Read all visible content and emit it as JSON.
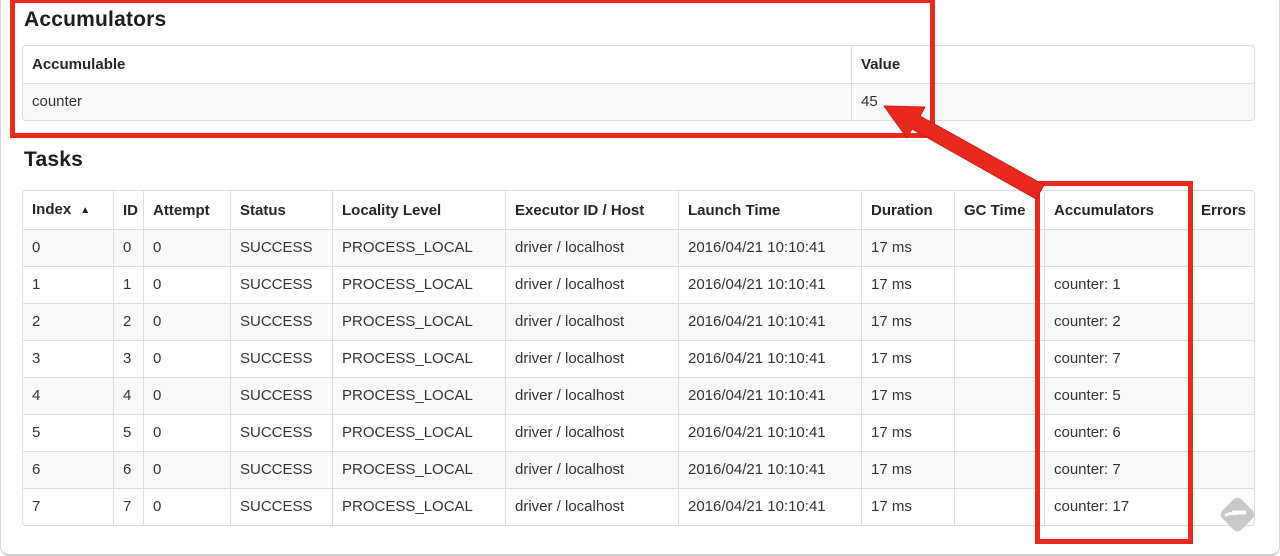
{
  "accumulators_section": {
    "title": "Accumulators",
    "table": {
      "headers": [
        "Accumulable",
        "Value"
      ],
      "rows": [
        {
          "accumulable": "counter",
          "value": "45"
        }
      ]
    }
  },
  "tasks_section": {
    "title": "Tasks",
    "table": {
      "headers": [
        "Index",
        "ID",
        "Attempt",
        "Status",
        "Locality Level",
        "Executor ID / Host",
        "Launch Time",
        "Duration",
        "GC Time",
        "Accumulators",
        "Errors"
      ],
      "sort_column": "Index",
      "sort_direction": "ascending",
      "sort_icon": "▲",
      "rows": [
        {
          "index": "0",
          "id": "0",
          "attempt": "0",
          "status": "SUCCESS",
          "locality_level": "PROCESS_LOCAL",
          "executor_id_host": "driver / localhost",
          "launch_time": "2016/04/21 10:10:41",
          "duration": "17 ms",
          "gc_time": "",
          "accumulators": "",
          "errors": ""
        },
        {
          "index": "1",
          "id": "1",
          "attempt": "0",
          "status": "SUCCESS",
          "locality_level": "PROCESS_LOCAL",
          "executor_id_host": "driver / localhost",
          "launch_time": "2016/04/21 10:10:41",
          "duration": "17 ms",
          "gc_time": "",
          "accumulators": "counter: 1",
          "errors": ""
        },
        {
          "index": "2",
          "id": "2",
          "attempt": "0",
          "status": "SUCCESS",
          "locality_level": "PROCESS_LOCAL",
          "executor_id_host": "driver / localhost",
          "launch_time": "2016/04/21 10:10:41",
          "duration": "17 ms",
          "gc_time": "",
          "accumulators": "counter: 2",
          "errors": ""
        },
        {
          "index": "3",
          "id": "3",
          "attempt": "0",
          "status": "SUCCESS",
          "locality_level": "PROCESS_LOCAL",
          "executor_id_host": "driver / localhost",
          "launch_time": "2016/04/21 10:10:41",
          "duration": "17 ms",
          "gc_time": "",
          "accumulators": "counter: 7",
          "errors": ""
        },
        {
          "index": "4",
          "id": "4",
          "attempt": "0",
          "status": "SUCCESS",
          "locality_level": "PROCESS_LOCAL",
          "executor_id_host": "driver / localhost",
          "launch_time": "2016/04/21 10:10:41",
          "duration": "17 ms",
          "gc_time": "",
          "accumulators": "counter: 5",
          "errors": ""
        },
        {
          "index": "5",
          "id": "5",
          "attempt": "0",
          "status": "SUCCESS",
          "locality_level": "PROCESS_LOCAL",
          "executor_id_host": "driver / localhost",
          "launch_time": "2016/04/21 10:10:41",
          "duration": "17 ms",
          "gc_time": "",
          "accumulators": "counter: 6",
          "errors": ""
        },
        {
          "index": "6",
          "id": "6",
          "attempt": "0",
          "status": "SUCCESS",
          "locality_level": "PROCESS_LOCAL",
          "executor_id_host": "driver / localhost",
          "launch_time": "2016/04/21 10:10:41",
          "duration": "17 ms",
          "gc_time": "",
          "accumulators": "counter: 7",
          "errors": ""
        },
        {
          "index": "7",
          "id": "7",
          "attempt": "0",
          "status": "SUCCESS",
          "locality_level": "PROCESS_LOCAL",
          "executor_id_host": "driver / localhost",
          "launch_time": "2016/04/21 10:10:41",
          "duration": "17 ms",
          "gc_time": "",
          "accumulators": "counter: 17",
          "errors": ""
        }
      ]
    }
  },
  "annotations": {
    "highlight_color": "#e9291d",
    "highlighted_regions": [
      "accumulators-summary-table",
      "tasks-accumulators-column"
    ],
    "arrow_points_to": "45"
  },
  "icons": {
    "sort_ascending": "▲",
    "watermark": "annotation-stamp"
  }
}
